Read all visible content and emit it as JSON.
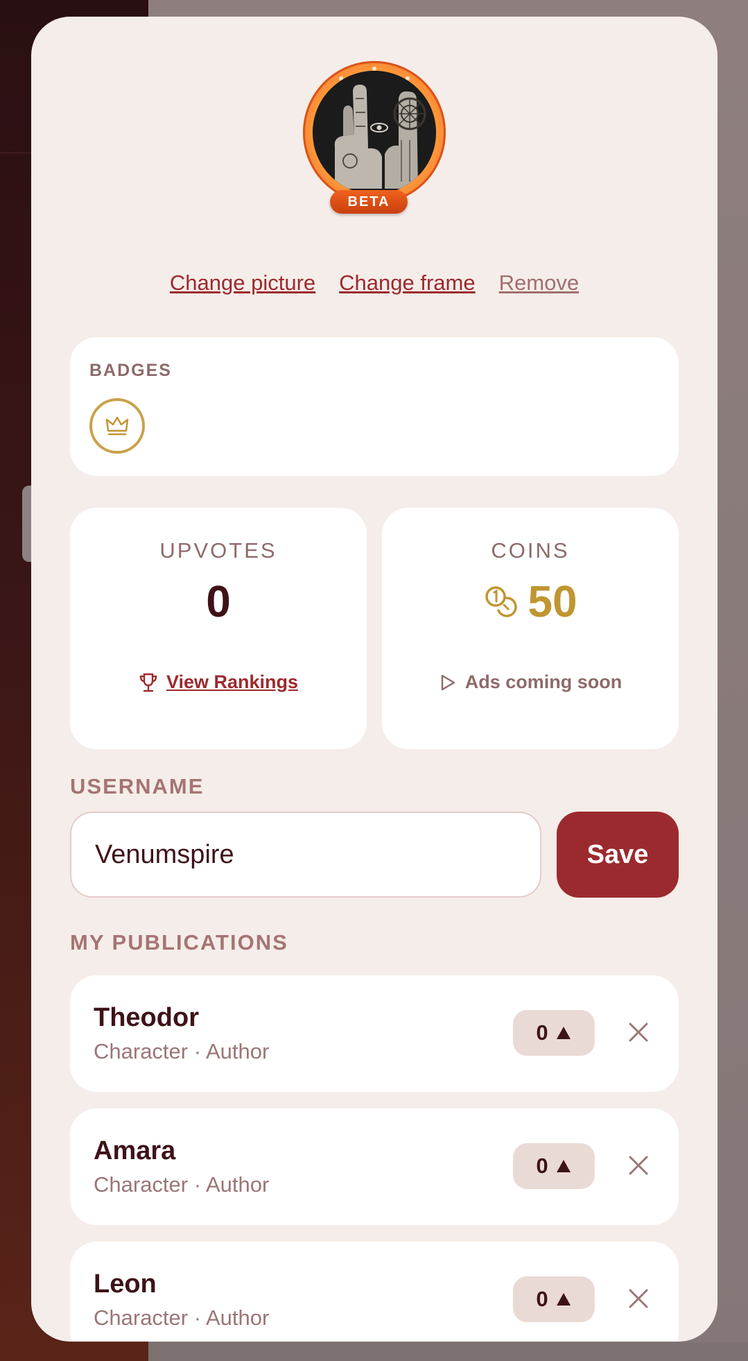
{
  "profile": {
    "avatar_badge": "BETA",
    "links": {
      "change_picture": "Change picture",
      "change_frame": "Change frame",
      "remove": "Remove"
    }
  },
  "badges": {
    "title": "BADGES",
    "items": [
      {
        "icon": "crown-icon"
      }
    ]
  },
  "stats": {
    "upvotes": {
      "label": "UPVOTES",
      "value": "0",
      "action_label": "View Rankings",
      "action_icon": "trophy-icon"
    },
    "coins": {
      "label": "COINS",
      "value": "50",
      "value_icon": "coins-icon",
      "action_label": "Ads coming soon",
      "action_icon": "play-icon"
    }
  },
  "username": {
    "title": "USERNAME",
    "value": "Venumspire",
    "save_label": "Save"
  },
  "publications": {
    "title": "MY PUBLICATIONS",
    "items": [
      {
        "title": "Theodor",
        "subtitle": "Character · Author",
        "votes": "0"
      },
      {
        "title": "Amara",
        "subtitle": "Character · Author",
        "votes": "0"
      },
      {
        "title": "Leon",
        "subtitle": "Character · Author",
        "votes": "0"
      }
    ]
  },
  "colors": {
    "accent": "#9b2a2e",
    "gold": "#c09632",
    "modal_bg": "#f5ede9",
    "frame_orange": "#f07a1e"
  }
}
